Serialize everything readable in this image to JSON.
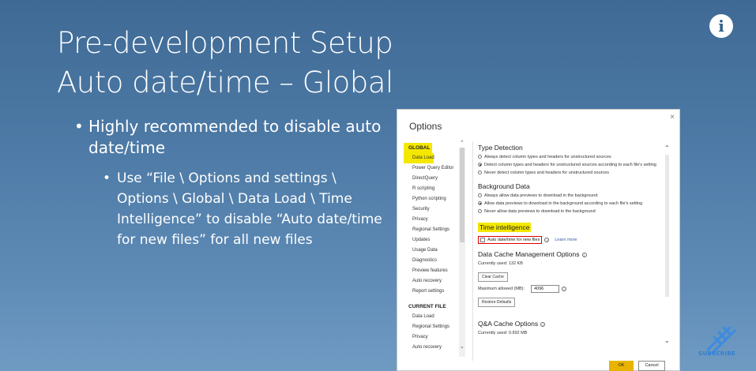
{
  "slide": {
    "title_line1": "Pre-development Setup",
    "title_line2": "Auto date/time – Global",
    "info_glyph": "i",
    "bullet1": "Highly recommended to disable auto date/time",
    "bullet2": "Use “File \\ Options and settings \\ Options \\ Global \\ Data Load \\ Time Intelligence” to disable “Auto date/time for new files” for all new files"
  },
  "dialog": {
    "title": "Options",
    "close_glyph": "×",
    "global_header": "GLOBAL",
    "global_items": [
      "Data Load",
      "Power Query Editor",
      "DirectQuery",
      "R scripting",
      "Python scripting",
      "Security",
      "Privacy",
      "Regional Settings",
      "Updates",
      "Usage Data",
      "Diagnostics",
      "Preview features",
      "Auto recovery",
      "Report settings"
    ],
    "current_header": "CURRENT FILE",
    "current_items": [
      "Data Load",
      "Regional Settings",
      "Privacy",
      "Auto recovery"
    ],
    "type_detection": {
      "heading": "Type Detection",
      "options": [
        "Always detect column types and headers for unstructured sources",
        "Detect column types and headers for unstructured sources according to each file's setting",
        "Never detect column types and headers for unstructured sources"
      ],
      "selected_index": 1
    },
    "background_data": {
      "heading": "Background Data",
      "options": [
        "Always allow data previews to download in the background",
        "Allow data previews to download in the background according to each file's setting",
        "Never allow data previews to download in the background"
      ],
      "selected_index": 1
    },
    "time_intelligence": {
      "heading": "Time intelligence",
      "checkbox_label": "Auto date/time for new files",
      "checked": false,
      "learn_more": "Learn more"
    },
    "data_cache": {
      "heading": "Data Cache Management Options",
      "currently_used": "Currently used: 132 KB",
      "clear_cache": "Clear Cache",
      "max_label": "Maximum allowed (MB):",
      "max_value": "4096",
      "restore_defaults": "Restore Defaults"
    },
    "qa_cache": {
      "heading": "Q&A Cache Options",
      "currently_used": "Currently used: 0.992 MB"
    },
    "ok_label": "OK",
    "cancel_label": "Cancel"
  },
  "subscribe_label": "SUBSCRIBE",
  "colors": {
    "highlight": "#f5e800",
    "ok_button": "#e8b400",
    "checkbox_outline": "#e00000",
    "link": "#2f5ea8"
  }
}
